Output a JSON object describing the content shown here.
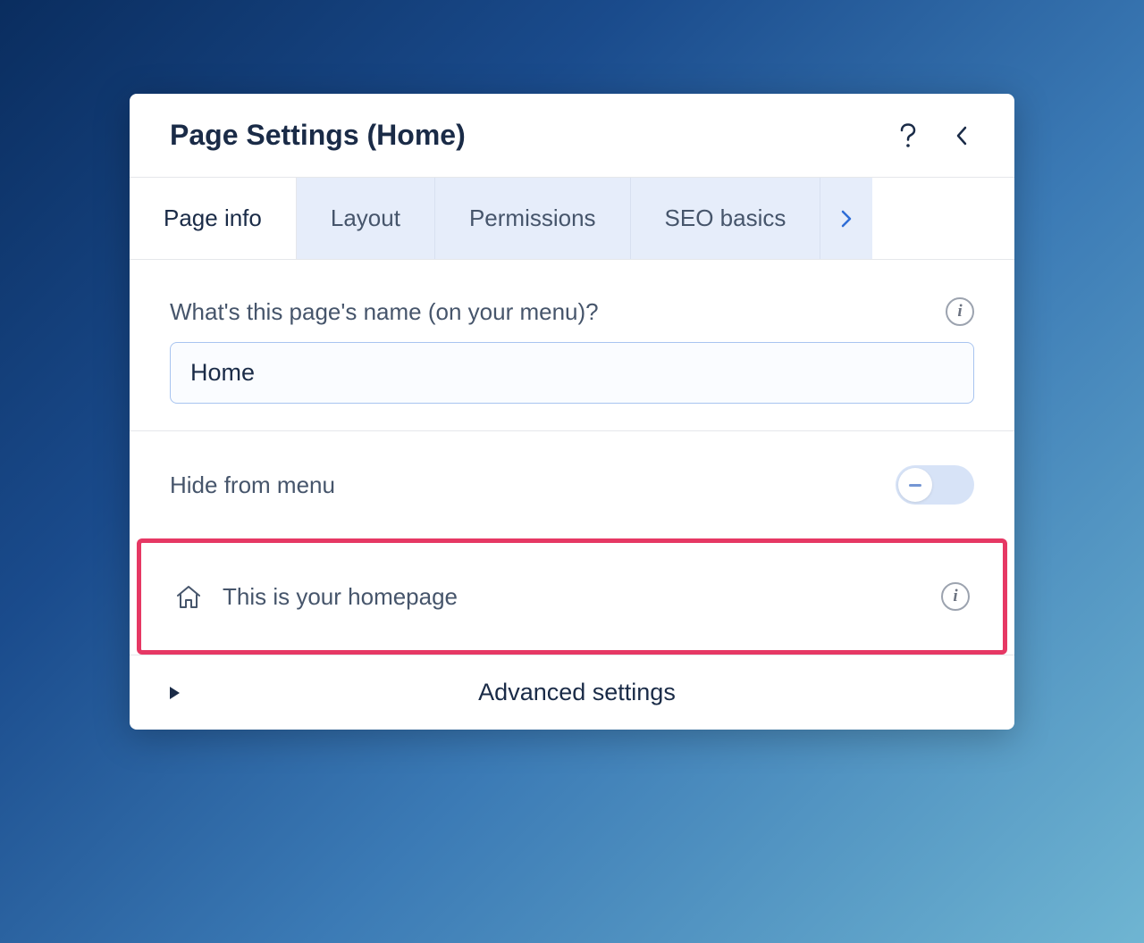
{
  "header": {
    "title": "Page Settings (Home)"
  },
  "tabs": {
    "items": [
      {
        "label": "Page info"
      },
      {
        "label": "Layout"
      },
      {
        "label": "Permissions"
      },
      {
        "label": "SEO basics"
      }
    ]
  },
  "pageNameField": {
    "label": "What's this page's name (on your menu)?",
    "value": "Home"
  },
  "hideFromMenu": {
    "label": "Hide from menu",
    "enabled": false
  },
  "homepageNotice": {
    "text": "This is your homepage"
  },
  "advanced": {
    "label": "Advanced settings"
  }
}
